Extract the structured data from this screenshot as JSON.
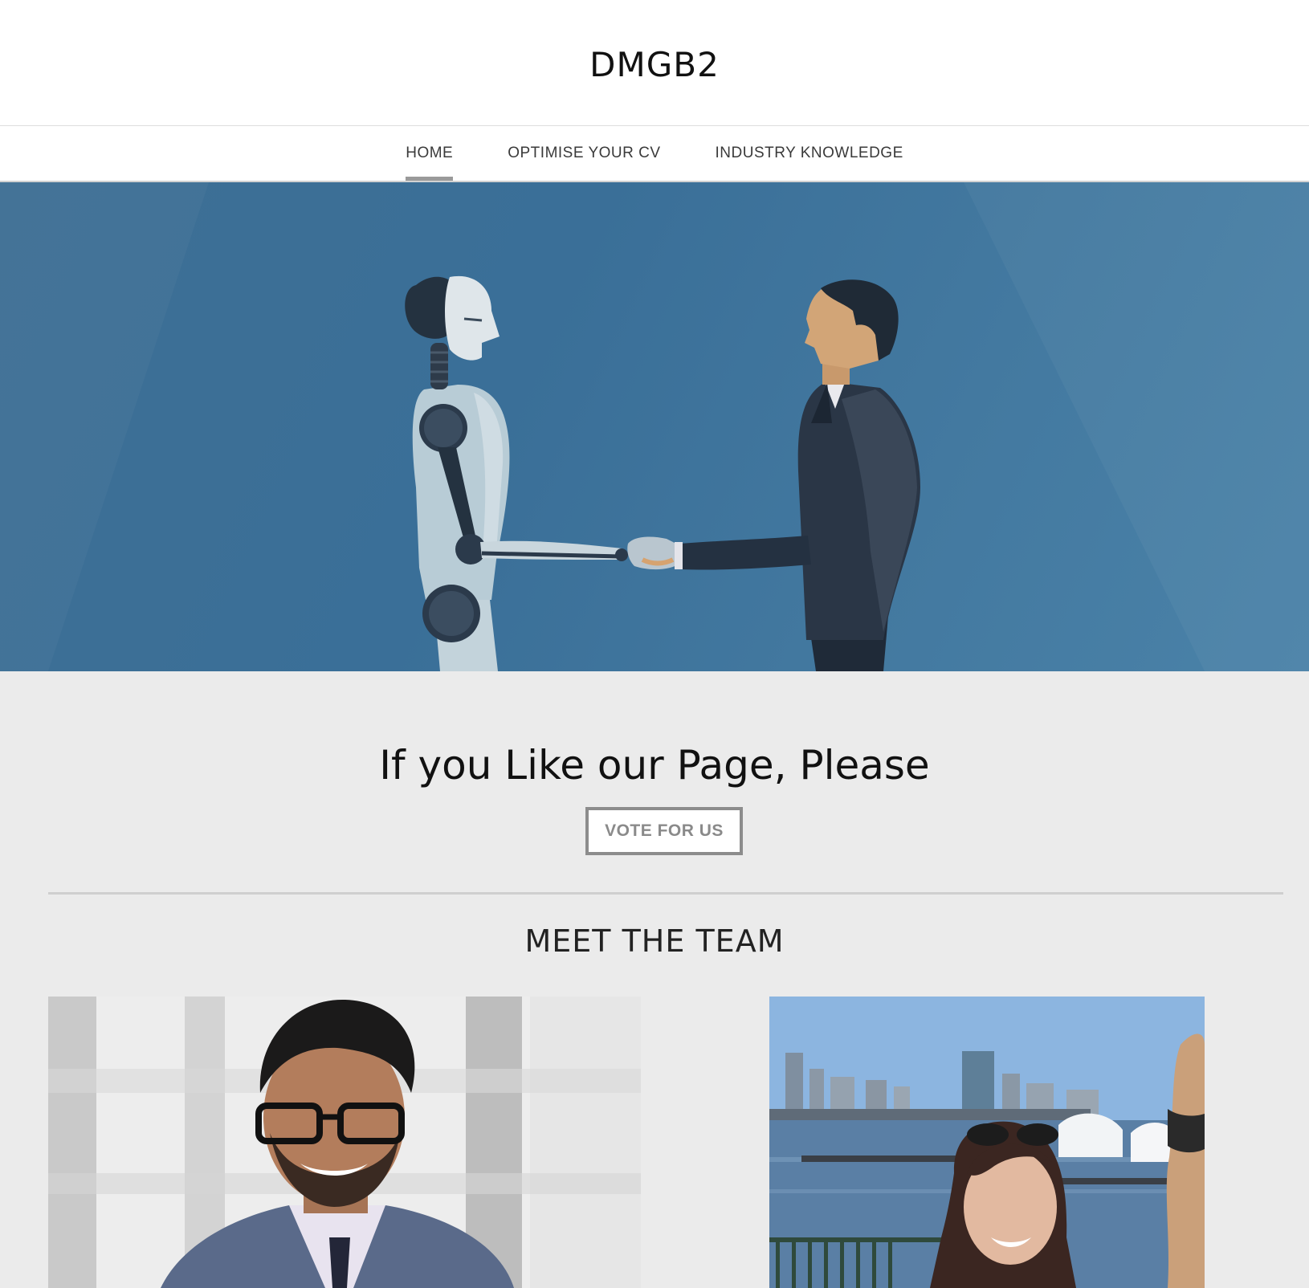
{
  "site": {
    "title": "DMGB2"
  },
  "nav": {
    "items": [
      {
        "label": "HOME",
        "active": true
      },
      {
        "label": "OPTIMISE YOUR CV",
        "active": false
      },
      {
        "label": "INDUSTRY KNOWLEDGE",
        "active": false
      }
    ]
  },
  "hero": {
    "image": "robot-human-handshake-illustration",
    "background_color": "#3b6f97"
  },
  "cta": {
    "heading": "If you Like our Page, Please",
    "button_label": "VOTE FOR US"
  },
  "team": {
    "heading": "MEET THE TEAM",
    "members": [
      {
        "photo": "man-portrait-glasses-suit"
      },
      {
        "photo": "woman-portrait-harbor-skyline"
      }
    ]
  }
}
